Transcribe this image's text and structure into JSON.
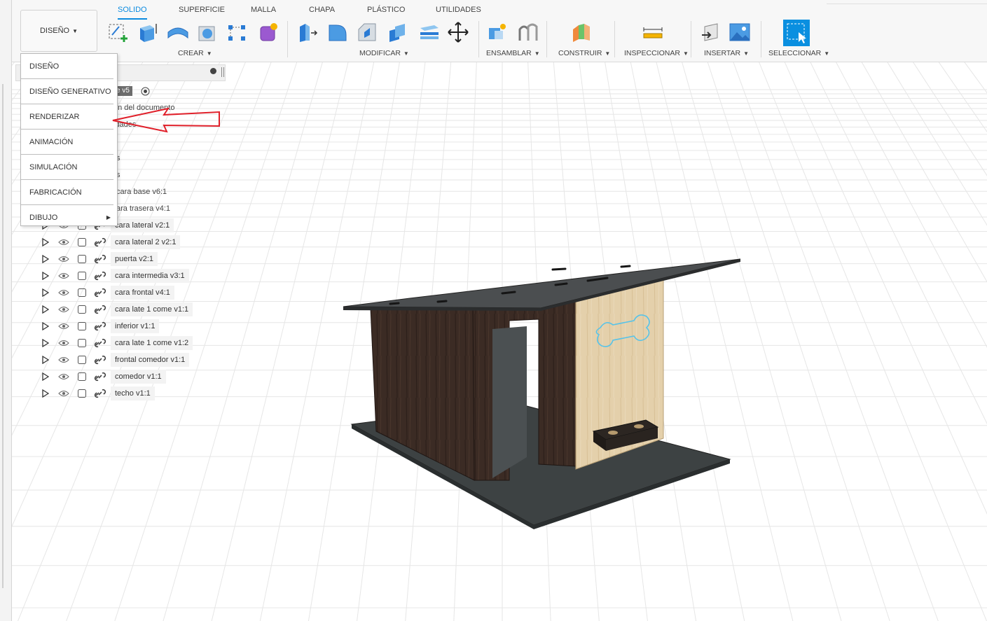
{
  "workspace": {
    "label": "DISEÑO"
  },
  "tabs": [
    {
      "label": "SOLIDO",
      "active": true
    },
    {
      "label": "SUPERFICIE"
    },
    {
      "label": "MALLA"
    },
    {
      "label": "CHAPA"
    },
    {
      "label": "PLÁSTICO"
    },
    {
      "label": "UTILIDADES"
    }
  ],
  "groups": {
    "crear": "CREAR",
    "modificar": "MODIFICAR",
    "ensamblar": "ENSAMBLAR",
    "construir": "CONSTRUIR",
    "inspeccionar": "INSPECCIONAR",
    "insertar": "INSERTAR",
    "seleccionar": "SELECCIONAR"
  },
  "workspace_menu": [
    {
      "label": "DISEÑO"
    },
    {
      "label": "DISEÑO GENERATIVO"
    },
    {
      "label": "RENDERIZAR"
    },
    {
      "label": "ANIMACIÓN"
    },
    {
      "label": "SIMULACIÓN"
    },
    {
      "label": "FABRICACIÓN"
    },
    {
      "label": "DIBUJO"
    }
  ],
  "browser": {
    "root_fragment": "e v5",
    "frag_1": "ón del documento",
    "frag_2": "idades",
    "frag_3": "s",
    "frag_4": "s",
    "frag_5": "cara base v6:1",
    "frag_6": "ara trasera v4:1",
    "components": [
      {
        "label": "cara lateral v2:1"
      },
      {
        "label": "cara lateral 2 v2:1"
      },
      {
        "label": "puerta v2:1"
      },
      {
        "label": "cara intermedia v3:1"
      },
      {
        "label": "cara frontal v4:1"
      },
      {
        "label": "cara late 1 come v1:1"
      },
      {
        "label": "inferior v1:1"
      },
      {
        "label": "cara late 1 come v1:2"
      },
      {
        "label": "frontal comedor v1:1"
      },
      {
        "label": "comedor v1:1"
      },
      {
        "label": "techo v1:1"
      }
    ]
  },
  "colors": {
    "accent": "#0b8be0",
    "annotation_arrow": "#e0202a",
    "dark_wood": "#3a2a22",
    "light_wood": "#e3cfa8",
    "base": "#3d4243"
  }
}
